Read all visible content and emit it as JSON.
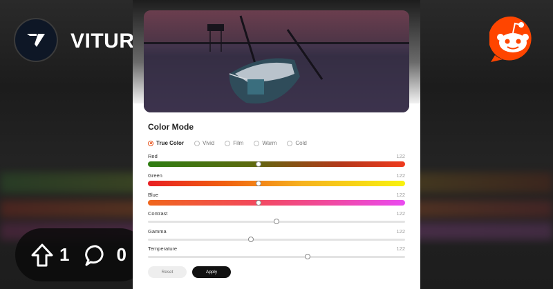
{
  "brand": {
    "name": "VITURE"
  },
  "social": {
    "upvotes": "1",
    "comments": "0"
  },
  "panel": {
    "section_title": "Color Mode",
    "modes": [
      {
        "label": "True Color",
        "selected": true
      },
      {
        "label": "Vivid",
        "selected": false
      },
      {
        "label": "Film",
        "selected": false
      },
      {
        "label": "Warm",
        "selected": false
      },
      {
        "label": "Cold",
        "selected": false
      }
    ],
    "sliders": [
      {
        "label": "Red",
        "value": "122",
        "level": 0.43
      },
      {
        "label": "Green",
        "value": "122",
        "level": 0.43
      },
      {
        "label": "Blue",
        "value": "122",
        "level": 0.43
      },
      {
        "label": "Contrast",
        "value": "122",
        "level": 0.5
      },
      {
        "label": "Gamma",
        "value": "122",
        "level": 0.4
      },
      {
        "label": "Temperature",
        "value": "122",
        "level": 0.62
      }
    ],
    "buttons": {
      "reset": "Reset",
      "apply": "Apply"
    }
  },
  "colors": {
    "accent": "#e8541e",
    "reddit": "#ff4500"
  }
}
